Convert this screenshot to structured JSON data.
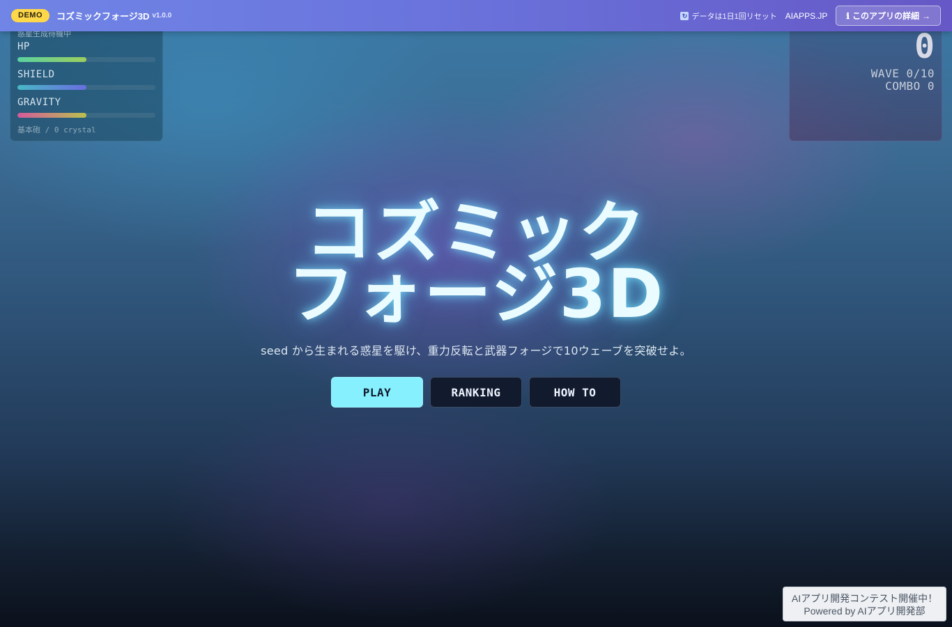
{
  "topbar": {
    "badge": "DEMO",
    "title": "コズミックフォージ3D",
    "version": "v1.0.0",
    "reset_note": "データは1日1回リセット",
    "site": "AIAPPS.JP",
    "detail_button": "このアプリの詳細",
    "detail_arrow": "→",
    "info_glyph": "ℹ",
    "reset_glyph": "🔄"
  },
  "status": {
    "planet_status": "惑星生成待機中",
    "stats": [
      {
        "label": "HP",
        "level": 0.5
      },
      {
        "label": "SHIELD",
        "level": 0.5
      },
      {
        "label": "GRAVITY",
        "level": 0.5
      }
    ],
    "weapon_line": "基本砲 / 0 crystal"
  },
  "score": {
    "value": "0",
    "wave": "WAVE 0/10",
    "combo": "COMBO 0"
  },
  "hero": {
    "title_line1": "コズミック",
    "title_line2": "フォージ3D",
    "subtitle": "seed から生まれる惑星を駆け、重力反転と武器フォージで10ウェーブを突破せよ。"
  },
  "menu": {
    "play": "PLAY",
    "ranking": "RANKING",
    "howto": "HOW TO"
  },
  "contest": {
    "line1": "AIアプリ開発コンテスト開催中！",
    "line2": "Powered by AIアプリ開発部"
  },
  "colors": {
    "accent": "#86f0ff",
    "badge": "#ffd84a",
    "topbar": "#6a74dc"
  }
}
